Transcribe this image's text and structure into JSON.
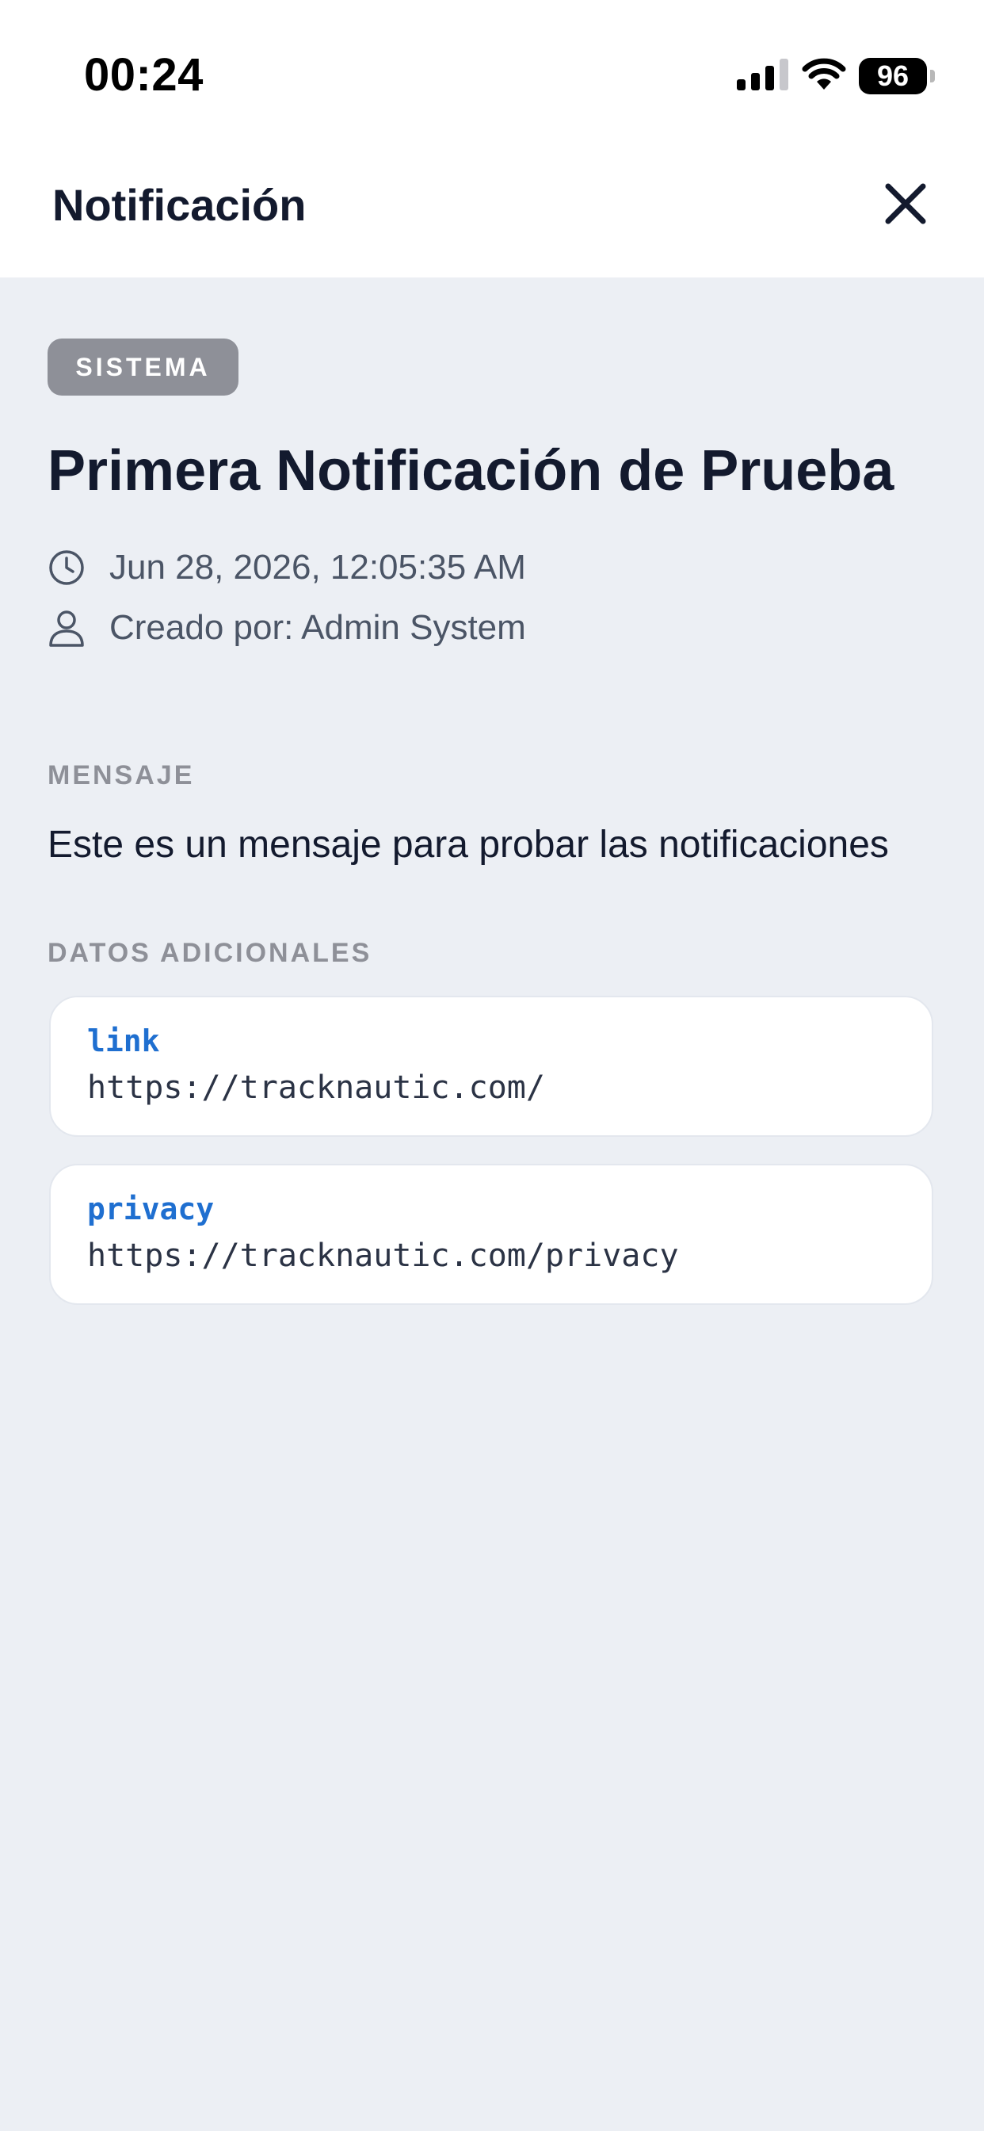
{
  "status_bar": {
    "time": "00:24",
    "battery": "96",
    "icons": [
      "signal-icon",
      "wifi-icon",
      "battery-icon"
    ]
  },
  "header": {
    "title": "Notificación",
    "close_icon": "close-icon"
  },
  "notification": {
    "badge": "SISTEMA",
    "title": "Primera Notificación de Prueba",
    "timestamp": "Jun 28, 2026, 12:05:35 AM",
    "created_by": "Creado por: Admin System",
    "message_label": "MENSAJE",
    "message": "Este es un mensaje para probar las notificaciones",
    "extra_label": "DATOS ADICIONALES",
    "extra_data": [
      {
        "key": "link",
        "value": "https://tracknautic.com/"
      },
      {
        "key": "privacy",
        "value": "https://tracknautic.com/privacy"
      }
    ]
  },
  "colors": {
    "background": "#ECEFF4",
    "surface": "#FFFFFF",
    "text_primary": "#131A2E",
    "text_secondary": "#4B5566",
    "muted": "#8E9098",
    "key_accent": "#1F6FD0"
  }
}
